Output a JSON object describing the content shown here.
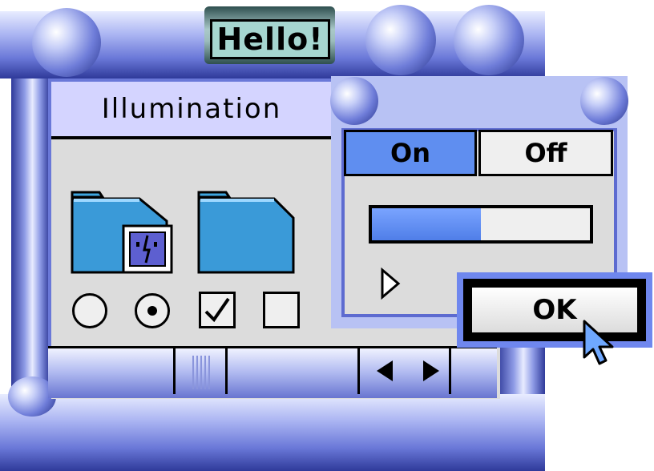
{
  "app": {
    "title": "Hello!"
  },
  "window": {
    "title": "Illumination"
  },
  "folders": [
    {
      "name": "folder-with-finder-icon"
    },
    {
      "name": "folder-icon"
    }
  ],
  "controls": {
    "radio_1_checked": false,
    "radio_2_checked": true,
    "checkbox_1_checked": true,
    "checkbox_2_checked": false
  },
  "switch": {
    "on_label": "On",
    "off_label": "Off",
    "selected": "On"
  },
  "progress": {
    "fraction": 0.5
  },
  "dialog": {
    "ok_label": "OK"
  },
  "icons": [
    "disclosure-triangle-icon",
    "arrow-left-icon",
    "arrow-right-icon",
    "scroll-grip-icon",
    "cursor-icon"
  ],
  "colors": {
    "accent": "#5f8ef0",
    "frame": "#6a78d8",
    "title_bg": "#d4d4ff",
    "hello_bg": "#a6d6d0"
  }
}
